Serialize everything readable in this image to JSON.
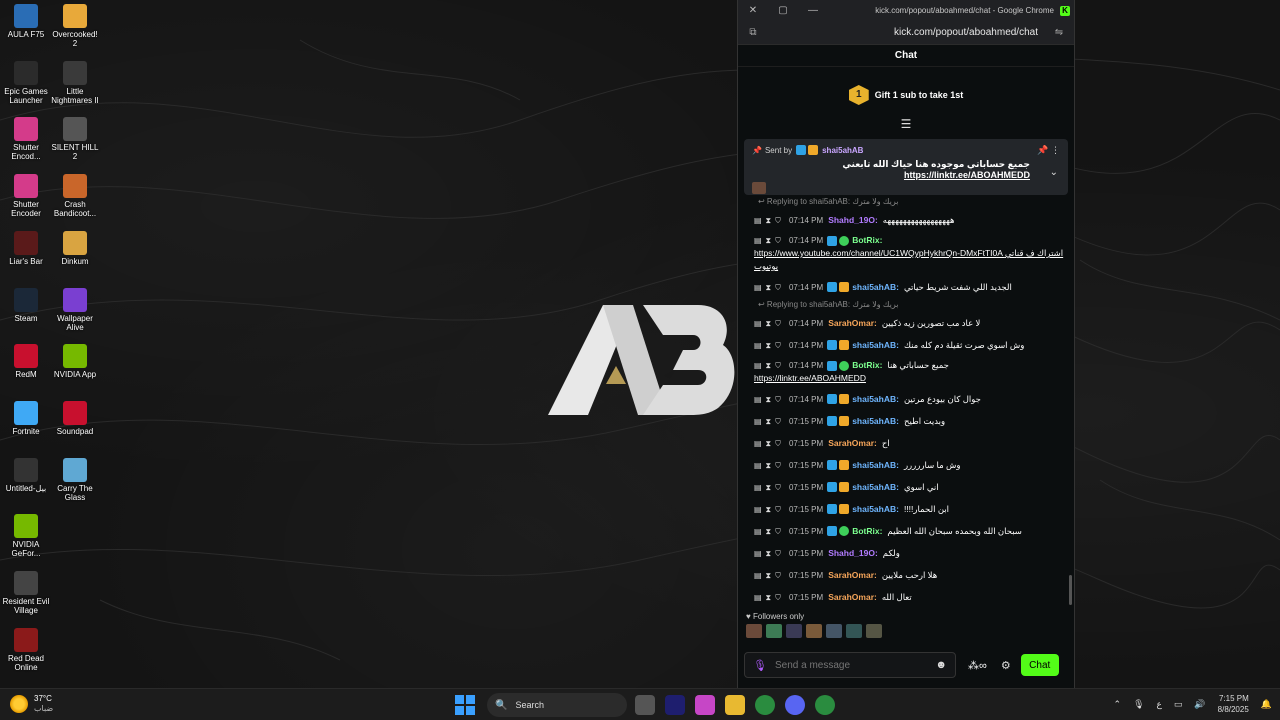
{
  "desktop": {
    "left_column": [
      {
        "label": "AULA F75",
        "color": "#2a6db5"
      },
      {
        "label": "Epic Games Launcher",
        "color": "#2b2b2b"
      },
      {
        "label": "Shutter Encod...",
        "color": "#d43b8a"
      },
      {
        "label": "Shutter Encoder",
        "color": "#d43b8a"
      },
      {
        "label": "Liar's Bar",
        "color": "#5a1a1a"
      },
      {
        "label": "Steam",
        "color": "#1b2838"
      },
      {
        "label": "RedM",
        "color": "#c8102e"
      },
      {
        "label": "Fortnite",
        "color": "#3fa9f5"
      },
      {
        "label": "Untitled-بيل",
        "color": "#333333"
      },
      {
        "label": "NVIDIA GeFor...",
        "color": "#76b900"
      },
      {
        "label": "Resident Evil Village",
        "color": "#444444"
      },
      {
        "label": "Red Dead Online",
        "color": "#8b1a1a"
      }
    ],
    "right_column": [
      {
        "label": "Overcooked! 2",
        "color": "#e8a93a"
      },
      {
        "label": "Little Nightmares II",
        "color": "#3a3a3a"
      },
      {
        "label": "SILENT HILL 2",
        "color": "#555555"
      },
      {
        "label": "Crash Bandicoot...",
        "color": "#c9662a"
      },
      {
        "label": "Dinkum",
        "color": "#d9a441"
      },
      {
        "label": "Wallpaper Alive",
        "color": "#7a3fd1"
      },
      {
        "label": "NVIDIA App",
        "color": "#76b900"
      },
      {
        "label": "Soundpad",
        "color": "#c8102e"
      },
      {
        "label": "Carry The Glass",
        "color": "#5fa8d3"
      }
    ]
  },
  "browser": {
    "window_title": "kick.com/popout/aboahmed/chat - Google Chrome",
    "url": "kick.com/popout/aboahmed/chat"
  },
  "chat": {
    "header": "Chat",
    "gift_count": "1",
    "gift_text": "Gift 1 sub to take 1st",
    "pinned": {
      "sent_by_label": "Sent by",
      "user": "shai5ahAB",
      "message_prefix": "جميع حساباتي موجوده هنا حياك الله تابعني",
      "link": "https://linktr.ee/ABOAHMEDD"
    },
    "messages": [
      {
        "reply": "Replying to shai5ahAB: بريك ولا مترك",
        "time": "07:14 PM",
        "user": "Shahd_19O",
        "user_color": "purple",
        "text": "هههههههههههههههههه"
      },
      {
        "time": "07:14 PM",
        "user": "BotRix",
        "user_color": "green",
        "link": "https://www.youtube.com/channel/UC1WQypHykhrQn-DMxFtTI0A",
        "text": "اشتراك ف قناتي يوتيوب"
      },
      {
        "time": "07:14 PM",
        "user": "shai5ahAB",
        "user_color": "blue",
        "text": "الجديد اللي شفت شريط حياتي"
      },
      {
        "reply": "Replying to shai5ahAB: بريك ولا مترك",
        "time": "07:14 PM",
        "user": "SarahOmar",
        "user_color": "orange",
        "text": "لا عاد مب تصورين زيه ذكيين"
      },
      {
        "time": "07:14 PM",
        "user": "shai5ahAB",
        "user_color": "blue",
        "text": "وش اسوي صرت ثقيلة دم كله منك"
      },
      {
        "time": "07:14 PM",
        "user": "BotRix",
        "user_color": "green",
        "text": "جميع حساباتي هنا",
        "link": "https://linktr.ee/ABOAHMEDD"
      },
      {
        "time": "07:14 PM",
        "user": "shai5ahAB",
        "user_color": "blue",
        "text": "جوال كان بيودع مرتين"
      },
      {
        "time": "07:15 PM",
        "user": "shai5ahAB",
        "user_color": "blue",
        "text": "وبديت اطيح"
      },
      {
        "time": "07:15 PM",
        "user": "SarahOmar",
        "user_color": "orange",
        "text": "اح"
      },
      {
        "time": "07:15 PM",
        "user": "shai5ahAB",
        "user_color": "blue",
        "text": "وش ما ساررررر"
      },
      {
        "time": "07:15 PM",
        "user": "shai5ahAB",
        "user_color": "blue",
        "text": "اني اسوي"
      },
      {
        "time": "07:15 PM",
        "user": "shai5ahAB",
        "user_color": "blue",
        "text": "!!!!ابن الحمار"
      },
      {
        "time": "07:15 PM",
        "user": "BotRix",
        "user_color": "green",
        "text": "سبحان الله وبحمده سبحان الله العظيم"
      },
      {
        "time": "07:15 PM",
        "user": "Shahd_19O",
        "user_color": "purple",
        "text": "ولكم"
      },
      {
        "time": "07:15 PM",
        "user": "SarahOmar",
        "user_color": "orange",
        "text": "هلا ارحب ملايين"
      },
      {
        "time": "07:15 PM",
        "user": "SarahOmar",
        "user_color": "orange",
        "text": "تعال الله"
      }
    ],
    "followers_only": "Followers only",
    "input_placeholder": "Send a message",
    "chat_button": "Chat"
  },
  "taskbar": {
    "temperature": "37°C",
    "weather_desc": "ضباب",
    "search_label": "Search",
    "time": "7:15 PM",
    "date": "8/8/2025",
    "lang": "ع"
  }
}
